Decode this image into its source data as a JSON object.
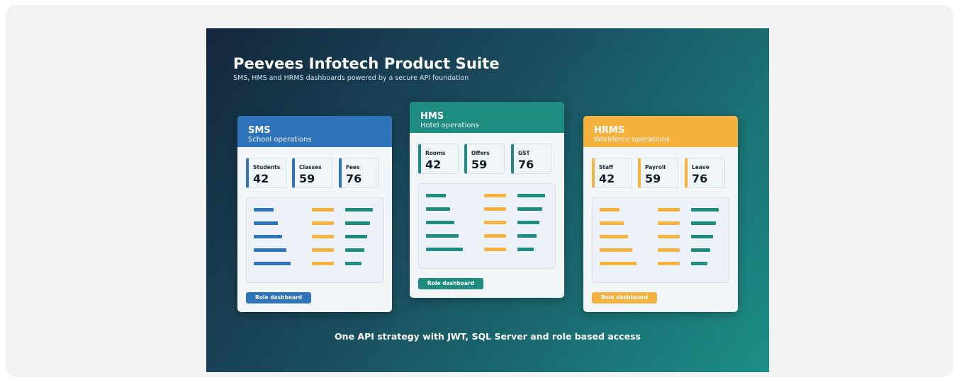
{
  "banner": {
    "title": "Peevees Infotech Product Suite",
    "subtitle": "SMS, HMS and HRMS dashboards powered by a secure API foundation",
    "footer": "One API strategy with JWT, SQL Server and role based access"
  },
  "colors": {
    "sms": "#2f73bb",
    "hms": "#1f8c82",
    "hrms": "#f5b23f",
    "teal_bar": "#1f8c82",
    "amber_bar": "#f5b23f"
  },
  "cards": {
    "sms": {
      "name": "SMS",
      "description": "School operations",
      "stats": [
        {
          "label": "Students",
          "value": "42"
        },
        {
          "label": "Classes",
          "value": "59"
        },
        {
          "label": "Fees",
          "value": "76"
        }
      ],
      "button": "Role dashboard"
    },
    "hms": {
      "name": "HMS",
      "description": "Hotel operations",
      "stats": [
        {
          "label": "Rooms",
          "value": "42"
        },
        {
          "label": "Offers",
          "value": "59"
        },
        {
          "label": "GST",
          "value": "76"
        }
      ],
      "button": "Role dashboard"
    },
    "hrms": {
      "name": "HRMS",
      "description": "Workforce operations",
      "stats": [
        {
          "label": "Staff",
          "value": "42"
        },
        {
          "label": "Payroll",
          "value": "59"
        },
        {
          "label": "Leave",
          "value": "76"
        }
      ],
      "button": "Role dashboard"
    }
  }
}
